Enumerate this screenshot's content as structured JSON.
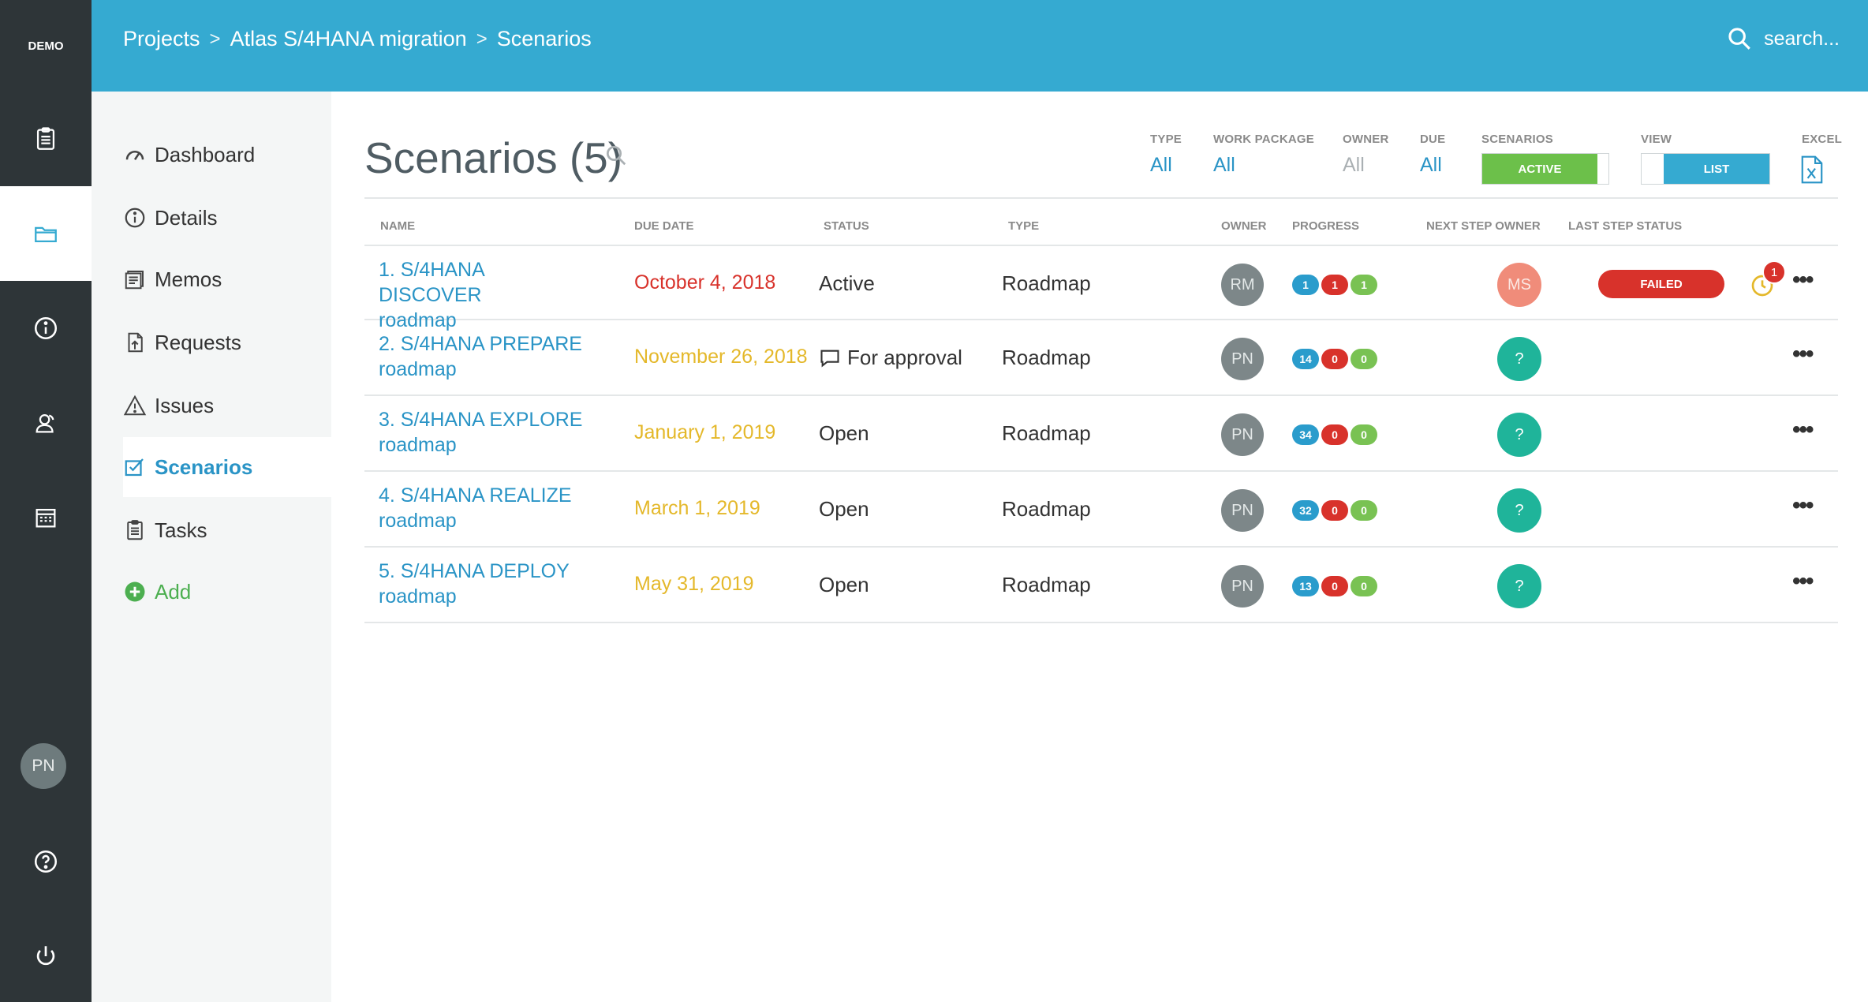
{
  "app": {
    "brand": "DEMO",
    "user_initials": "PN"
  },
  "breadcrumb": [
    "Projects",
    "Atlas S/4HANA migration",
    "Scenarios"
  ],
  "breadcrumb_separator": ">",
  "search": {
    "placeholder": "search..."
  },
  "rail": [
    "clipboard-icon",
    "folder-icon",
    "info-icon",
    "users-icon",
    "calendar-icon",
    "help-icon",
    "power-icon"
  ],
  "subnav": {
    "items": [
      {
        "label": "Dashboard",
        "icon": "gauge-icon"
      },
      {
        "label": "Details",
        "icon": "info-icon"
      },
      {
        "label": "Memos",
        "icon": "memo-icon"
      },
      {
        "label": "Requests",
        "icon": "request-icon"
      },
      {
        "label": "Issues",
        "icon": "warning-icon"
      },
      {
        "label": "Scenarios",
        "icon": "scenario-icon",
        "active": true
      },
      {
        "label": "Tasks",
        "icon": "tasks-icon"
      },
      {
        "label": "Add",
        "icon": "add-icon"
      }
    ]
  },
  "page": {
    "title": "Scenarios (5)"
  },
  "filters": {
    "type": {
      "label": "TYPE",
      "value": "All"
    },
    "work_package": {
      "label": "WORK PACKAGE",
      "value": "All"
    },
    "owner": {
      "label": "OWNER",
      "value": "All"
    },
    "due": {
      "label": "DUE",
      "value": "All"
    },
    "scenarios": {
      "label": "SCENARIOS",
      "value": "ACTIVE"
    },
    "view": {
      "label": "VIEW",
      "value": "LIST"
    },
    "excel": {
      "label": "EXCEL"
    }
  },
  "table": {
    "headers": [
      "NAME",
      "DUE DATE",
      "STATUS",
      "TYPE",
      "OWNER",
      "PROGRESS",
      "NEXT STEP OWNER",
      "LAST STEP STATUS"
    ],
    "rows": [
      {
        "name_line1": "1. S/4HANA DISCOVER",
        "name_line2": "roadmap",
        "due": "October 4, 2018",
        "due_color": "#d8322b",
        "status": "Active",
        "type": "Roadmap",
        "owner": "RM",
        "progress": [
          "1",
          "1",
          "1"
        ],
        "next_step_owner": "MS",
        "last_step_status": "FAILED",
        "notifications": "1"
      },
      {
        "name_line1": "2. S/4HANA PREPARE",
        "name_line2": "roadmap",
        "due": "November 26, 2018",
        "due_color": "#e4b82a",
        "status": "For approval",
        "type": "Roadmap",
        "owner": "PN",
        "progress": [
          "14",
          "0",
          "0"
        ],
        "next_step_owner": "?"
      },
      {
        "name_line1": "3. S/4HANA EXPLORE",
        "name_line2": "roadmap",
        "due": "January 1, 2019",
        "due_color": "#e4b82a",
        "status": "Open",
        "type": "Roadmap",
        "owner": "PN",
        "progress": [
          "34",
          "0",
          "0"
        ],
        "next_step_owner": "?"
      },
      {
        "name_line1": "4. S/4HANA REALIZE",
        "name_line2": "roadmap",
        "due": "March 1, 2019",
        "due_color": "#e4b82a",
        "status": "Open",
        "type": "Roadmap",
        "owner": "PN",
        "progress": [
          "32",
          "0",
          "0"
        ],
        "next_step_owner": "?"
      },
      {
        "name_line1": "5. S/4HANA DEPLOY",
        "name_line2": "roadmap",
        "due": "May 31, 2019",
        "due_color": "#e4b82a",
        "status": "Open",
        "type": "Roadmap",
        "owner": "PN",
        "progress": [
          "13",
          "0",
          "0"
        ],
        "next_step_owner": "?"
      }
    ],
    "more_label": "•••"
  },
  "colors": {
    "accent": "#35aad1",
    "rail": "#2e3538",
    "active_green": "#6cc04a",
    "list_blue": "#35aad1",
    "failed_red": "#d8322b"
  }
}
